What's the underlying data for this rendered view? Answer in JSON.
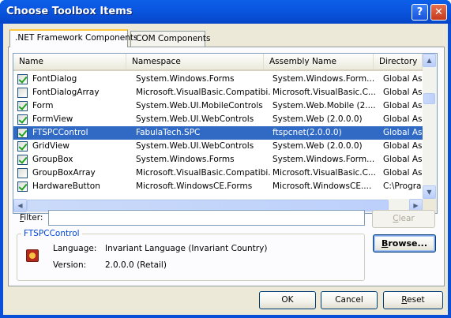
{
  "window": {
    "title": "Choose Toolbox Items",
    "help_glyph": "?",
    "close_glyph": "✕"
  },
  "tabs": [
    {
      "label": ".NET Framework Components"
    },
    {
      "label": "COM Components"
    }
  ],
  "table": {
    "columns": [
      "Name",
      "Namespace",
      "Assembly Name",
      "Directory"
    ],
    "rows": [
      {
        "checked": true,
        "name": "FontDialog",
        "namespace": "System.Windows.Forms",
        "assembly": "System.Windows.Form...",
        "directory": "Global Ass"
      },
      {
        "checked": false,
        "name": "FontDialogArray",
        "namespace": "Microsoft.VisualBasic.Compatibi...",
        "assembly": "Microsoft.VisualBasic.C...",
        "directory": "Global Ass"
      },
      {
        "checked": true,
        "name": "Form",
        "namespace": "System.Web.UI.MobileControls",
        "assembly": "System.Web.Mobile (2....",
        "directory": "Global Ass"
      },
      {
        "checked": true,
        "name": "FormView",
        "namespace": "System.Web.UI.WebControls",
        "assembly": "System.Web (2.0.0.0)",
        "directory": "Global Ass"
      },
      {
        "checked": true,
        "name": "FTSPCControl",
        "namespace": "FabulaTech.SPC",
        "assembly": "ftspcnet(2.0.0.0)",
        "directory": "Global Ass",
        "selected": true
      },
      {
        "checked": true,
        "name": "GridView",
        "namespace": "System.Web.UI.WebControls",
        "assembly": "System.Web (2.0.0.0)",
        "directory": "Global Ass"
      },
      {
        "checked": true,
        "name": "GroupBox",
        "namespace": "System.Windows.Forms",
        "assembly": "System.Windows.Form...",
        "directory": "Global Ass"
      },
      {
        "checked": false,
        "name": "GroupBoxArray",
        "namespace": "Microsoft.VisualBasic.Compatibi...",
        "assembly": "Microsoft.VisualBasic.C...",
        "directory": "Global Ass"
      },
      {
        "checked": true,
        "name": "HardwareButton",
        "namespace": "Microsoft.WindowsCE.Forms",
        "assembly": "Microsoft.WindowsCE....",
        "directory": "C:\\Progra"
      }
    ]
  },
  "filter": {
    "label_prefix": "F",
    "label_rest": "ilter:",
    "value": "",
    "clear_prefix": "C",
    "clear_rest": "lear"
  },
  "details": {
    "group_title": "FTSPCControl",
    "language_label": "Language:",
    "language_value": "Invariant Language (Invariant Country)",
    "version_label": "Version:",
    "version_value": "2.0.0.0 (Retail)"
  },
  "buttons": {
    "browse_prefix": "B",
    "browse_rest": "rowse...",
    "ok": "OK",
    "cancel": "Cancel",
    "reset_prefix": "R",
    "reset_rest": "eset"
  },
  "colors": {
    "title_bar": "#0a55e0",
    "selection": "#316ac5",
    "window_bg": "#ece9d8"
  }
}
